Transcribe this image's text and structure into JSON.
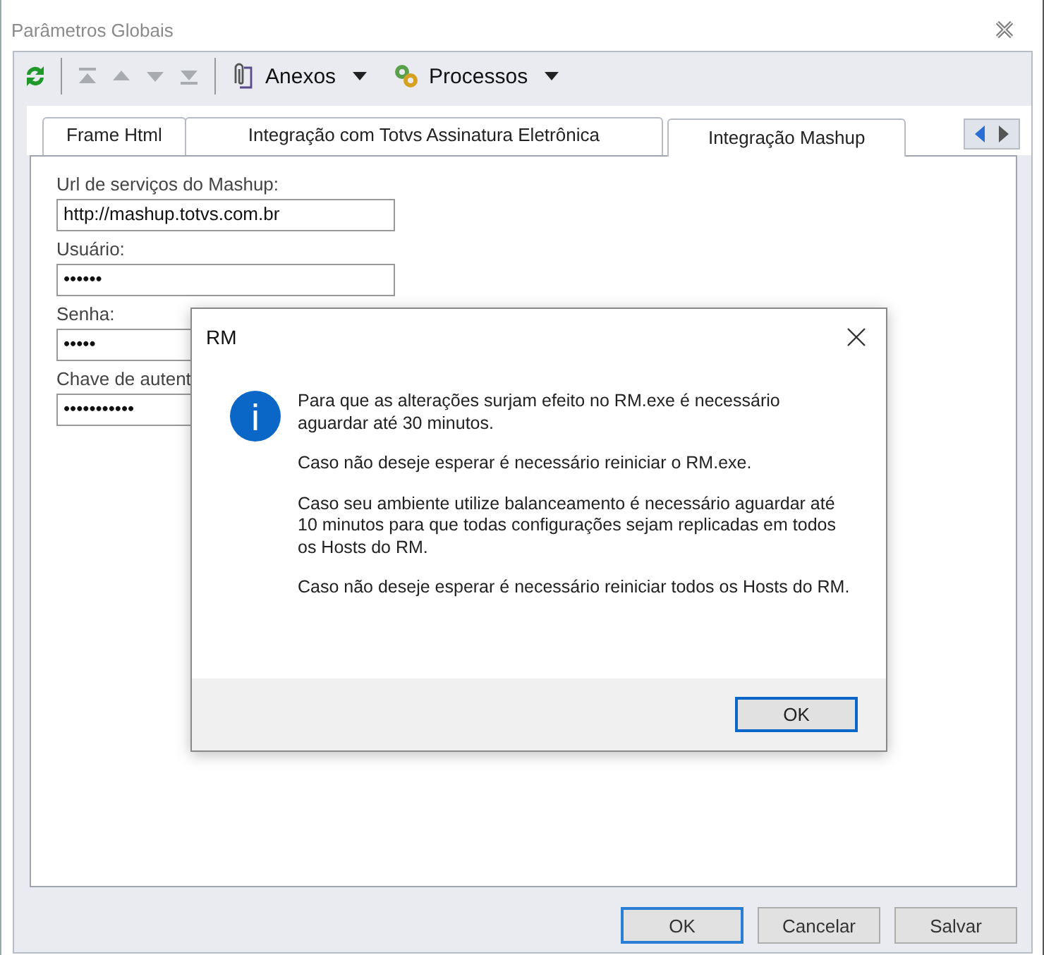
{
  "window": {
    "title": "Parâmetros Globais"
  },
  "toolbar": {
    "nav": [
      {
        "kind": "first",
        "disabled": true
      },
      {
        "kind": "prev",
        "disabled": true
      },
      {
        "kind": "next",
        "disabled": true
      },
      {
        "kind": "last",
        "disabled": true
      }
    ],
    "menus": [
      {
        "kind": "attachments",
        "label": "Anexos"
      },
      {
        "kind": "processes",
        "label": "Processos"
      }
    ]
  },
  "tabs": [
    {
      "label": "Frame Html",
      "selected": false
    },
    {
      "label": "Integração com Totvs Assinatura Eletrônica",
      "selected": false
    },
    {
      "label": "Integração Mashup",
      "selected": true
    }
  ],
  "fields": [
    {
      "label": "Url de serviços do Mashup:",
      "value": "http://mashup.totvs.com.br"
    },
    {
      "label": "Usuário:",
      "value": "••••••"
    },
    {
      "label": "Senha:",
      "value": "•••••"
    },
    {
      "label": "Chave de autent",
      "value": "•••••••••••"
    }
  ],
  "buttons": [
    {
      "label": "OK",
      "default": true
    },
    {
      "label": "Cancelar",
      "default": false
    },
    {
      "label": "Salvar",
      "default": false
    }
  ],
  "dialog": {
    "title": "RM",
    "paragraphs": [
      "Para que as alterações surjam efeito no RM.exe é necessário aguardar até 30 minutos.",
      "Caso não deseje esperar é necessário reiniciar o RM.exe.",
      "Caso seu ambiente utilize balanceamento é necessário aguardar até 10 minutos para que todas configurações sejam replicadas em todos os Hosts do RM.",
      "Caso não deseje esperar é necessário reiniciar todos os Hosts do RM."
    ],
    "buttons": [
      {
        "label": "OK",
        "default": true
      }
    ]
  }
}
